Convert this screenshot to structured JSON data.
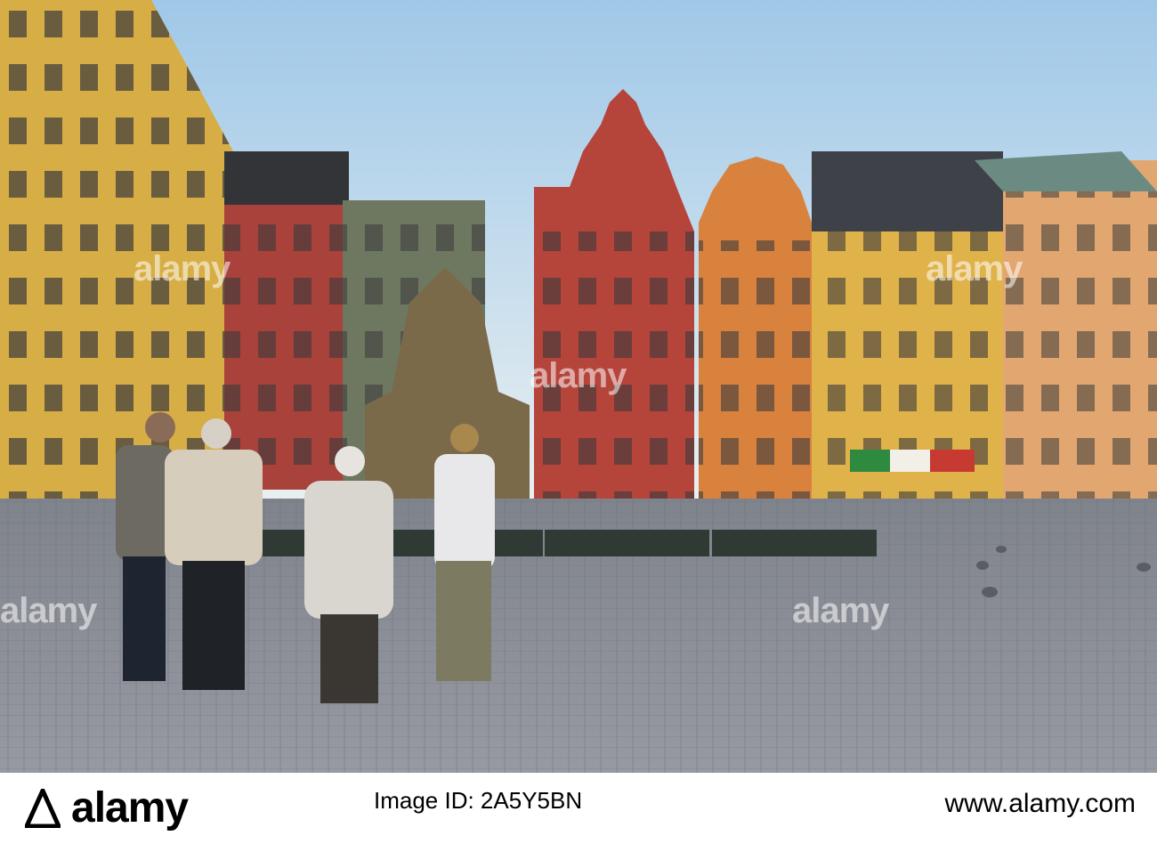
{
  "watermark": {
    "text": "alamy"
  },
  "footer": {
    "brand": "alamy",
    "image_id": "Image ID: 2A5Y5BN",
    "url": "www.alamy.com"
  },
  "colors": {
    "sky": "#cfe3f3",
    "cobble": "#8c8f96",
    "red_building": "#b5443a",
    "orange_building": "#d8823e",
    "yellow_building": "#e0b24a",
    "footer_bg": "#ffffff"
  }
}
